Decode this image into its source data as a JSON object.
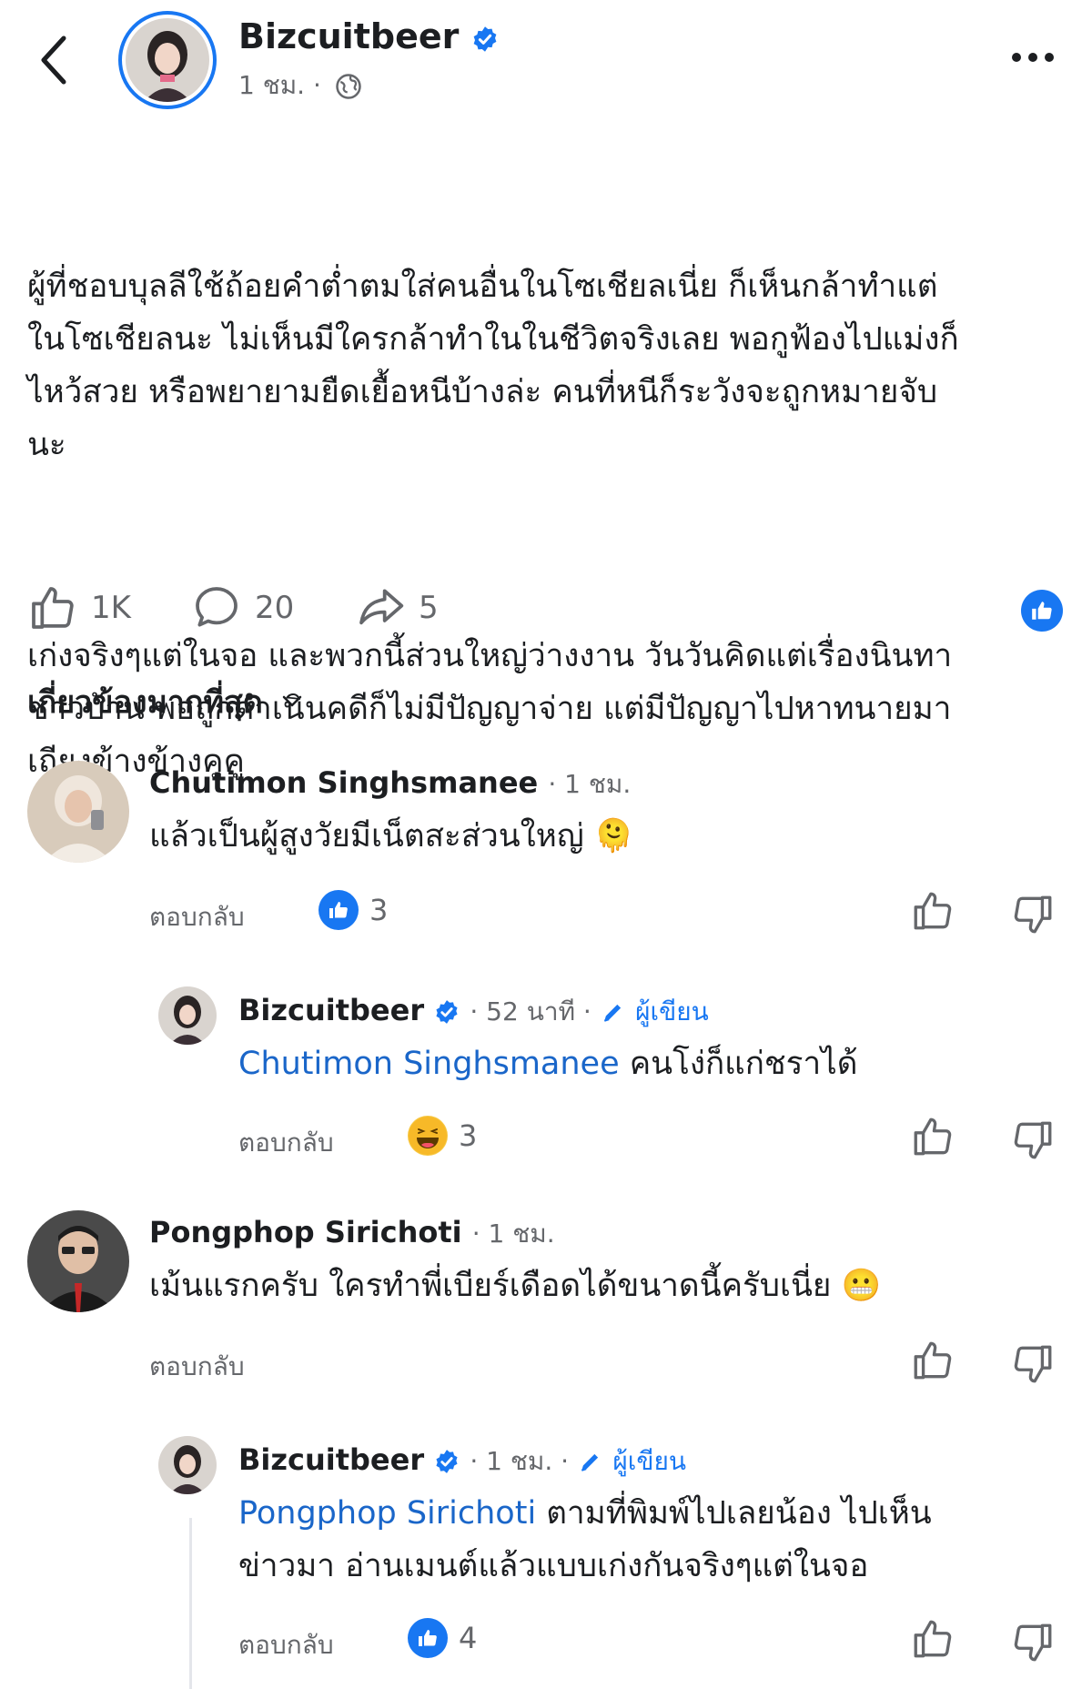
{
  "header": {
    "name": "Bizcuitbeer",
    "time": "1 ชม. ·"
  },
  "post": {
    "paragraph1": "ผู้ที่ชอบบุลลีใช้ถ้อยคำต่ำตมใส่คนอื่นในโซเชียลเนี่ย ก็เห็นกล้าทำแต่\nในโซเชียลนะ ไม่เห็นมีใครกล้าทำในในชีวิตจริงเลย พอกูฟ้องไปแม่งก็\nไหว้สวย หรือพยายามยืดเยื้อหนีบ้างล่ะ คนที่หนีก็ระวังจะถูกหมายจับ\nนะ",
    "paragraph2": "เก่งจริงๆแต่ในจอ และพวกนี้ส่วนใหญ่ว่างงาน วันวันคิดแต่เรื่องนินทา\nชาวบ้าน พอถูกดำเนินคดีก็ไม่มีปัญญาจ่าย แต่มีปัญญาไปหาทนายมา\nเถียงข้างข้างคูคู",
    "likes": "1K",
    "comments": "20",
    "shares": "5"
  },
  "sort_label": "เกี่ยวข้องมากที่สุด",
  "comments": [
    {
      "name": "Chutimon Singhsmanee",
      "time": "· 1 ชม.",
      "text": "แล้วเป็นผู้สูงวัยมีเน็ตสะส่วนใหญ่",
      "emoji": "🫠",
      "reply_label": "ตอบกลับ",
      "reaction_count": "3",
      "reaction": "like",
      "reply": {
        "name": "Bizcuitbeer",
        "time": "· 52 นาที ·",
        "author": "ผู้เขียน",
        "mention": "Chutimon Singhsmanee",
        "text": " คนโง่ก็แก่ชราได้",
        "reply_label": "ตอบกลับ",
        "reaction_count": "3",
        "reaction": "haha"
      }
    },
    {
      "name": "Pongphop Sirichoti",
      "time": "· 1 ชม.",
      "text": "เม้นแรกครับ ใครทำพี่เบียร์เดือดได้ขนาดนี้ครับเนี่ย",
      "emoji": "😬",
      "reply_label": "ตอบกลับ",
      "reply": {
        "name": "Bizcuitbeer",
        "time": "· 1 ชม. ·",
        "author": "ผู้เขียน",
        "mention": "Pongphop Sirichoti",
        "text_line1": " ตามที่พิมพ์ไปเลยน้อง ไปเห็น",
        "text_line2": "ข่าวมา อ่านเมนต์แล้วแบบเก่งกันจริงๆแต่ในจอ",
        "reply_label": "ตอบกลับ",
        "reaction_count": "4",
        "reaction": "like"
      }
    }
  ],
  "colors": {
    "accent": "#1877f2",
    "mention": "#1a66c9",
    "secondary_text": "#65676b"
  }
}
